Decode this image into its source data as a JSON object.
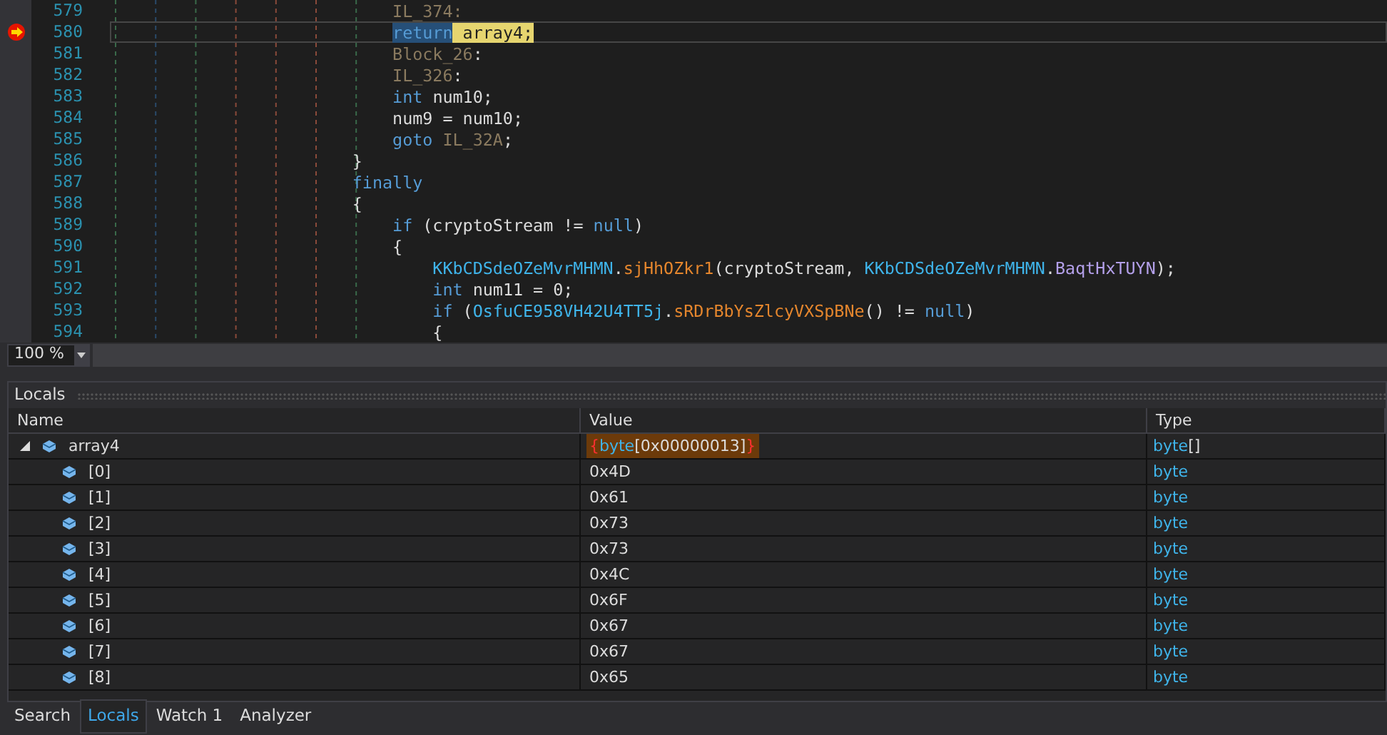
{
  "editor": {
    "lines": [
      {
        "number": "579",
        "current": false,
        "tokens": [
          {
            "text": "                            IL_374:",
            "kind": "label"
          }
        ]
      },
      {
        "number": "580",
        "current": true,
        "tokens": [
          {
            "text": "                            return",
            "kind": "keyword",
            "selected": true
          },
          {
            "text": " array4;",
            "kind": "plain",
            "selected": false
          }
        ]
      },
      {
        "number": "581",
        "current": false,
        "tokens": [
          {
            "text": "                            Block_26",
            "kind": "label"
          },
          {
            "text": ":",
            "kind": "plain"
          }
        ]
      },
      {
        "number": "582",
        "current": false,
        "tokens": [
          {
            "text": "                            IL_326",
            "kind": "label"
          },
          {
            "text": ":",
            "kind": "plain"
          }
        ]
      },
      {
        "number": "583",
        "current": false,
        "tokens": [
          {
            "text": "                            int",
            "kind": "keyword"
          },
          {
            "text": " num10;",
            "kind": "plain"
          }
        ]
      },
      {
        "number": "584",
        "current": false,
        "tokens": [
          {
            "text": "                            num9 = num10;",
            "kind": "plain"
          }
        ]
      },
      {
        "number": "585",
        "current": false,
        "tokens": [
          {
            "text": "                            goto",
            "kind": "keyword"
          },
          {
            "text": " IL_32A",
            "kind": "label"
          },
          {
            "text": ";",
            "kind": "plain"
          }
        ]
      },
      {
        "number": "586",
        "current": false,
        "tokens": [
          {
            "text": "                        }",
            "kind": "plain"
          }
        ]
      },
      {
        "number": "587",
        "current": false,
        "tokens": [
          {
            "text": "                        finally",
            "kind": "keyword"
          }
        ]
      },
      {
        "number": "588",
        "current": false,
        "tokens": [
          {
            "text": "                        {",
            "kind": "plain"
          }
        ]
      },
      {
        "number": "589",
        "current": false,
        "tokens": [
          {
            "text": "                            if",
            "kind": "keyword"
          },
          {
            "text": " (cryptoStream != ",
            "kind": "plain"
          },
          {
            "text": "null",
            "kind": "keyword"
          },
          {
            "text": ")",
            "kind": "plain"
          }
        ]
      },
      {
        "number": "590",
        "current": false,
        "tokens": [
          {
            "text": "                            {",
            "kind": "plain"
          }
        ]
      },
      {
        "number": "591",
        "current": false,
        "tokens": [
          {
            "text": "                                KKbCDSdeOZeMvrMHMN",
            "kind": "type"
          },
          {
            "text": ".",
            "kind": "plain"
          },
          {
            "text": "sjHhOZkr1",
            "kind": "method"
          },
          {
            "text": "(cryptoStream, ",
            "kind": "plain"
          },
          {
            "text": "KKbCDSdeOZeMvrMHMN",
            "kind": "type"
          },
          {
            "text": ".",
            "kind": "plain"
          },
          {
            "text": "BaqtHxTUYN",
            "kind": "field"
          },
          {
            "text": ");",
            "kind": "plain"
          }
        ]
      },
      {
        "number": "592",
        "current": false,
        "tokens": [
          {
            "text": "                                int",
            "kind": "keyword"
          },
          {
            "text": " num11 = 0;",
            "kind": "plain"
          }
        ]
      },
      {
        "number": "593",
        "current": false,
        "tokens": [
          {
            "text": "                                if",
            "kind": "keyword"
          },
          {
            "text": " (",
            "kind": "plain"
          },
          {
            "text": "OsfuCE958VH42U4TT5j",
            "kind": "type"
          },
          {
            "text": ".",
            "kind": "plain"
          },
          {
            "text": "sRDrBbYsZlcyVXSpBNe",
            "kind": "method"
          },
          {
            "text": "() != ",
            "kind": "plain"
          },
          {
            "text": "null",
            "kind": "keyword"
          },
          {
            "text": ")",
            "kind": "plain"
          }
        ]
      },
      {
        "number": "594",
        "current": false,
        "tokens": [
          {
            "text": "                                {",
            "kind": "plain"
          }
        ]
      }
    ],
    "zoom": "100 %"
  },
  "locals": {
    "title": "Locals",
    "columns": [
      "Name",
      "Value",
      "Type"
    ],
    "rows": [
      {
        "name": "array4",
        "expanded": true,
        "changed": true,
        "value": [
          {
            "text": "{",
            "kind": "brace"
          },
          {
            "text": "byte",
            "kind": "type"
          },
          {
            "text": "[0x00000013]",
            "kind": "plain"
          },
          {
            "text": "}",
            "kind": "brace"
          }
        ],
        "type": [
          {
            "text": "byte",
            "kind": "type"
          },
          {
            "text": "[]",
            "kind": "plain"
          }
        ],
        "children": [
          {
            "name": "[0]",
            "value": "0x4D",
            "type": "byte"
          },
          {
            "name": "[1]",
            "value": "0x61",
            "type": "byte"
          },
          {
            "name": "[2]",
            "value": "0x73",
            "type": "byte"
          },
          {
            "name": "[3]",
            "value": "0x73",
            "type": "byte"
          },
          {
            "name": "[4]",
            "value": "0x4C",
            "type": "byte"
          },
          {
            "name": "[5]",
            "value": "0x6F",
            "type": "byte"
          },
          {
            "name": "[6]",
            "value": "0x67",
            "type": "byte"
          },
          {
            "name": "[7]",
            "value": "0x67",
            "type": "byte"
          },
          {
            "name": "[8]",
            "value": "0x65",
            "type": "byte"
          }
        ]
      }
    ]
  },
  "bottom_tabs": [
    {
      "label": "Search",
      "selected": false
    },
    {
      "label": "Locals",
      "selected": true
    },
    {
      "label": "Watch 1",
      "selected": false
    },
    {
      "label": "Analyzer",
      "selected": false
    }
  ]
}
